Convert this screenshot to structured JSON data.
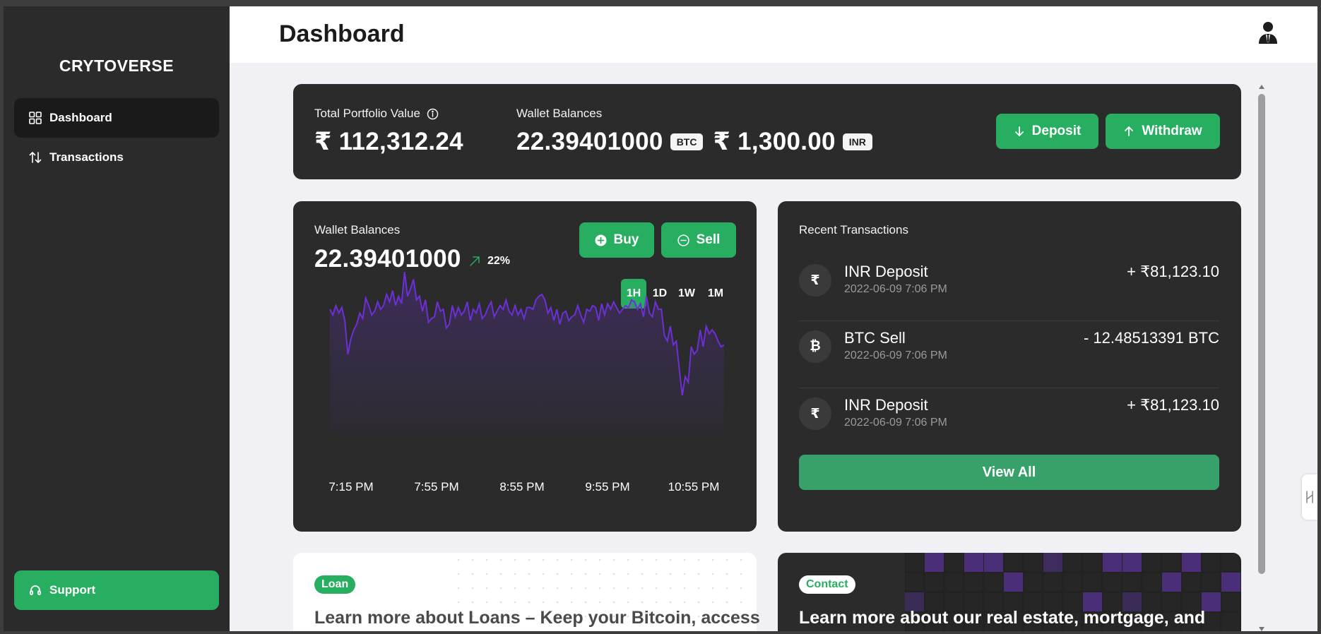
{
  "sidebar": {
    "brand": "CRYTOVERSE",
    "items": [
      {
        "label": "Dashboard",
        "icon": "grid-icon",
        "active": true
      },
      {
        "label": "Transactions",
        "icon": "arrows-updown-icon",
        "active": false
      }
    ],
    "support_label": "Support"
  },
  "header": {
    "title": "Dashboard"
  },
  "summary": {
    "portfolio_label": "Total Portfolio Value",
    "portfolio_value": "₹ 112,312.24",
    "wallet_label": "Wallet Balances",
    "btc_value": "22.39401000",
    "btc_unit": "BTC",
    "inr_value": "₹ 1,300.00",
    "inr_unit": "INR",
    "deposit_label": "Deposit",
    "withdraw_label": "Withdraw"
  },
  "wallet_card": {
    "label": "Wallet Balances",
    "value": "22.39401000",
    "change": "22%",
    "buy_label": "Buy",
    "sell_label": "Sell",
    "ranges": [
      "1H",
      "1D",
      "1W",
      "1M"
    ],
    "active_range": "1H"
  },
  "chart_data": {
    "type": "area",
    "x_ticks": [
      "7:15 PM",
      "7:55 PM",
      "8:55 PM",
      "9:55 PM",
      "10:55 PM"
    ],
    "values": [
      66,
      63,
      68,
      64,
      67,
      60,
      42,
      50,
      55,
      58,
      64,
      61,
      72,
      68,
      63,
      65,
      70,
      66,
      68,
      74,
      70,
      76,
      68,
      73,
      69,
      86,
      73,
      77,
      82,
      71,
      73,
      65,
      71,
      59,
      61,
      62,
      70,
      65,
      66,
      56,
      58,
      68,
      62,
      67,
      63,
      65,
      70,
      60,
      66,
      64,
      69,
      61,
      63,
      67,
      70,
      62,
      65,
      68,
      66,
      71,
      65,
      63,
      68,
      63,
      66,
      61,
      67,
      67,
      66,
      71,
      73,
      74,
      71,
      64,
      67,
      60,
      66,
      58,
      64,
      65,
      60,
      62,
      63,
      68,
      63,
      59,
      66,
      65,
      68,
      67,
      60,
      69,
      63,
      69,
      66,
      70,
      67,
      64,
      66,
      68,
      67,
      71,
      70,
      66,
      69,
      62,
      73,
      64,
      62,
      70,
      66,
      66,
      52,
      49,
      57,
      47,
      49,
      34,
      20,
      30,
      27,
      46,
      42,
      44,
      55,
      46,
      57,
      53,
      55,
      53,
      49,
      46,
      47
    ],
    "color": "#6d2fd6"
  },
  "transactions": {
    "title": "Recent Transactions",
    "rows": [
      {
        "icon": "₹",
        "name": "INR Deposit",
        "date": "2022-06-09 7:06 PM",
        "amount": "+ ₹81,123.10"
      },
      {
        "icon": "₿",
        "name": "BTC Sell",
        "date": "2022-06-09 7:06 PM",
        "amount": "- 12.48513391 BTC"
      },
      {
        "icon": "₹",
        "name": "INR Deposit",
        "date": "2022-06-09 7:06 PM",
        "amount": "+ ₹81,123.10"
      }
    ],
    "view_all_label": "View All"
  },
  "promo_loan": {
    "tag": "Loan",
    "text": "Learn more about Loans – Keep your Bitcoin, access"
  },
  "promo_contact": {
    "tag": "Contact",
    "text": "Learn more about our real estate, mortgage, and"
  }
}
